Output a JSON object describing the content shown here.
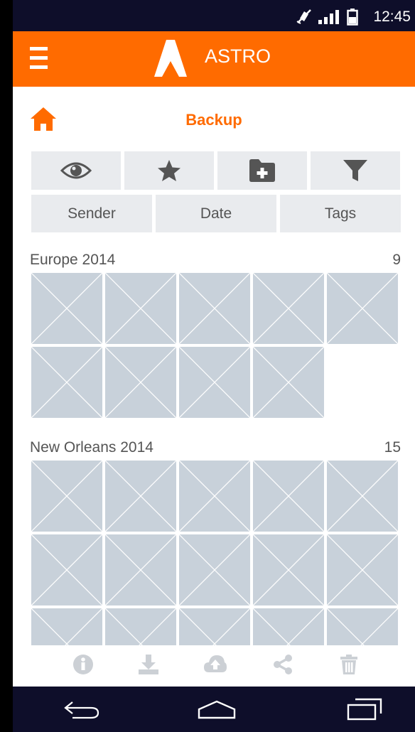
{
  "status_bar": {
    "time": "12:45",
    "icons": [
      "mute-icon",
      "signal-icon",
      "battery-icon"
    ]
  },
  "app_bar": {
    "title": "ASTRO",
    "menu_icon": "menu-icon",
    "logo_icon": "astro-logo-icon"
  },
  "location": {
    "home_icon": "home-icon",
    "title": "Backup"
  },
  "toolbar": {
    "buttons": [
      "view-icon",
      "favorite-icon",
      "add-folder-icon",
      "filter-icon"
    ]
  },
  "sort_options": [
    "Sender",
    "Date",
    "Tags"
  ],
  "groups": [
    {
      "title": "Europe 2014",
      "count": "9"
    },
    {
      "title": "New Orleans 2014",
      "count": "15"
    }
  ],
  "action_bar": {
    "buttons": [
      "info-icon",
      "download-icon",
      "upload-icon",
      "share-icon",
      "delete-icon"
    ]
  },
  "nav_bar": {
    "buttons": [
      "back-icon",
      "home-nav-icon",
      "recents-icon"
    ]
  },
  "colors": {
    "accent": "#ff6b00",
    "status_bar": "#0e0e2a",
    "button_bg": "#e9ebee",
    "thumbnail": "#c8d1da",
    "text": "#555555"
  }
}
